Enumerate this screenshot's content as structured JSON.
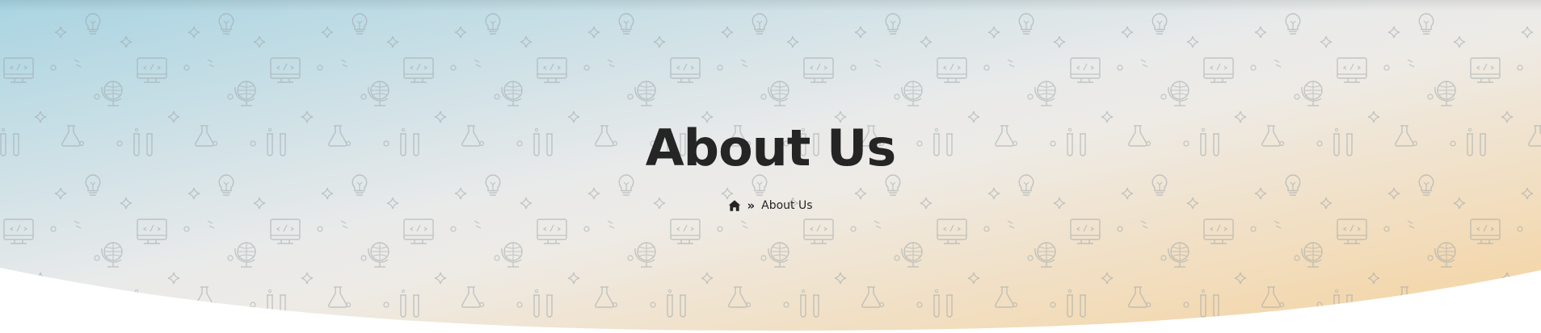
{
  "hero": {
    "title": "About Us",
    "colors": {
      "left": "#a9d5e3",
      "center": "#ececec",
      "right": "#f3d5a6",
      "pattern": "#9aa3a8",
      "text": "#252525"
    },
    "pattern_icons": [
      "lightbulb-icon",
      "sparkle-icon",
      "monitor-icon",
      "globe-icon",
      "test-tubes-icon"
    ]
  },
  "breadcrumb": {
    "home_icon": "home-icon",
    "separator": "»",
    "current": "About Us"
  }
}
